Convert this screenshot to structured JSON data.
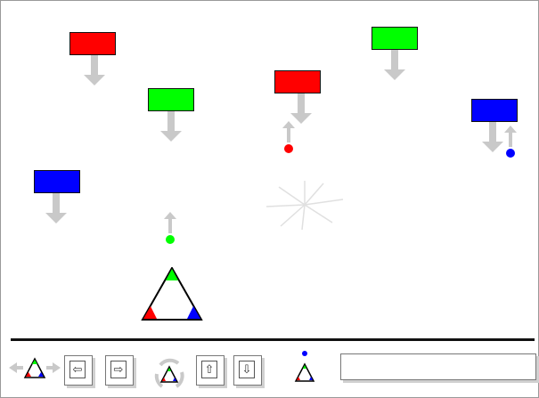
{
  "game": {
    "colors": {
      "red": "#ff0000",
      "green": "#00ff00",
      "blue": "#0000ff",
      "gray": "#c9c9c9",
      "dark": "#111111"
    },
    "falling_blocks": [
      {
        "color": "red",
        "direction": "down"
      },
      {
        "color": "green",
        "direction": "down"
      },
      {
        "color": "red",
        "direction": "down"
      },
      {
        "color": "green",
        "direction": "down"
      },
      {
        "color": "blue",
        "direction": "down"
      },
      {
        "color": "blue",
        "direction": "down"
      }
    ],
    "shots": [
      {
        "color": "red",
        "direction": "up"
      },
      {
        "color": "green",
        "direction": "up"
      },
      {
        "color": "blue",
        "direction": "up"
      }
    ],
    "effects": [
      "burst"
    ],
    "player": {
      "shape": "rgb-triangle",
      "corners": [
        "green",
        "red",
        "blue"
      ]
    }
  },
  "toolbar": {
    "icons": [
      "move-horizontal-icon",
      "left-arrow-key-icon",
      "right-arrow-key-icon",
      "rotate-icon",
      "up-arrow-key-icon",
      "down-arrow-key-icon",
      "fire-icon"
    ],
    "keys": {
      "left": "⇦",
      "right": "⇨",
      "up": "⇧",
      "down": "⇩"
    },
    "status_text": ""
  }
}
